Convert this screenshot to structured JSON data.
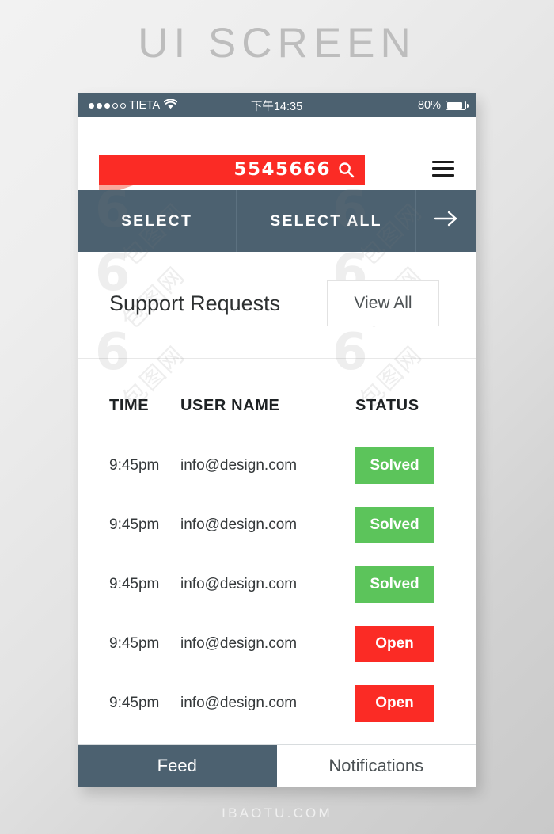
{
  "poster": {
    "title": "UI SCREEN",
    "footer": "IBAOTU.COM",
    "watermark_mark": "6",
    "watermark_text": "包图网"
  },
  "colors": {
    "accent_red": "#fb2b25",
    "accent_red_light": "#f9a79c",
    "slate": "#4c6170",
    "green": "#5cc45b",
    "text_dark": "#2e3132",
    "border_light": "#e2e2e2"
  },
  "statusbar": {
    "carrier": "TIETA",
    "signal_dots_filled": 3,
    "signal_dots_total": 5,
    "wifi_icon": "wifi-icon",
    "time": "下午14:35",
    "battery_percent": "80%",
    "battery_level": 80
  },
  "search": {
    "value": "5545666",
    "placeholder": "5545666",
    "icon": "search-icon"
  },
  "menu": {
    "icon": "hamburger-menu-icon"
  },
  "selectbar": {
    "select_label": "SELECT",
    "select_all_label": "SELECT ALL",
    "next_icon": "arrow-right-icon"
  },
  "section": {
    "title": "Support Requests",
    "view_all_label": "View All"
  },
  "table": {
    "columns": [
      "TIME",
      "USER NAME",
      "STATUS"
    ],
    "rows": [
      {
        "time": "9:45pm",
        "user": "info@design.com",
        "status": "Solved",
        "state": "solved"
      },
      {
        "time": "9:45pm",
        "user": "info@design.com",
        "status": "Solved",
        "state": "solved"
      },
      {
        "time": "9:45pm",
        "user": "info@design.com",
        "status": "Solved",
        "state": "solved"
      },
      {
        "time": "9:45pm",
        "user": "info@design.com",
        "status": "Open",
        "state": "open"
      },
      {
        "time": "9:45pm",
        "user": "info@design.com",
        "status": "Open",
        "state": "open"
      }
    ]
  },
  "tabbar": {
    "tabs": [
      {
        "label": "Feed",
        "active": true
      },
      {
        "label": "Notifications",
        "active": false
      }
    ]
  }
}
